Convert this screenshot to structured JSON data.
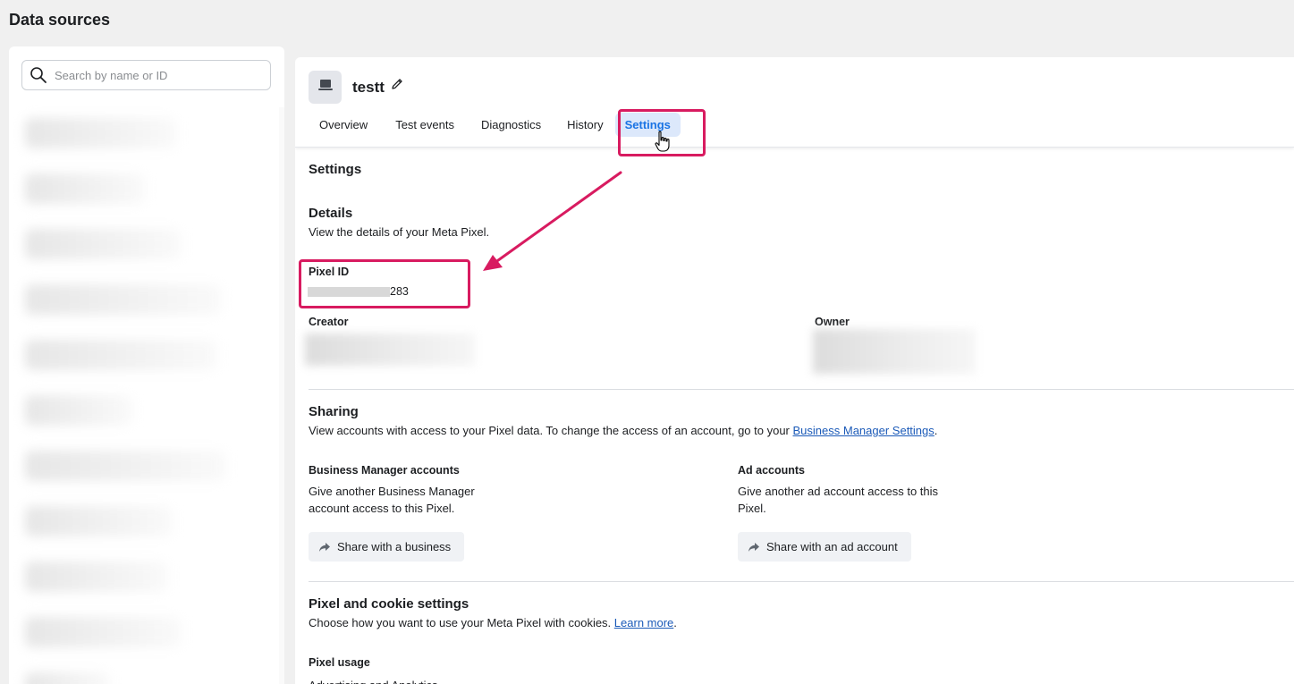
{
  "page": {
    "title": "Data sources"
  },
  "sidebar": {
    "search_placeholder": "Search by name or ID",
    "search_icon": "search-icon"
  },
  "pixel": {
    "name": "testt",
    "tile_icon": "monitor-icon",
    "edit_icon": "pencil-icon"
  },
  "tabs": [
    {
      "label": "Overview"
    },
    {
      "label": "Test events"
    },
    {
      "label": "Diagnostics"
    },
    {
      "label": "History"
    },
    {
      "label": "Settings",
      "active": true
    }
  ],
  "settings": {
    "heading": "Settings",
    "details": {
      "heading": "Details",
      "description": "View the details of your Meta Pixel.",
      "pixel_id_label": "Pixel ID",
      "pixel_id_suffix": "283",
      "creator_label": "Creator",
      "owner_label": "Owner"
    },
    "sharing": {
      "heading": "Sharing",
      "description": "View accounts with access to your Pixel data. To change the access of an account, go to your",
      "link": "Business Manager Settings",
      "after_link": ".",
      "business": {
        "title": "Business Manager accounts",
        "line1": "Give another Business Manager",
        "line2": "account access to this Pixel.",
        "button": "Share with a business",
        "button_icon": "share-arrow-icon"
      },
      "ad": {
        "title": "Ad accounts",
        "line1": "Give another ad account access to this",
        "line2": "Pixel.",
        "button": "Share with an ad account",
        "button_icon": "share-arrow-icon"
      }
    },
    "cookie": {
      "heading": "Pixel and cookie settings",
      "description": "Choose how you want to use your Meta Pixel with cookies.",
      "link": "Learn more",
      "after_link": ".",
      "usage_label": "Pixel usage",
      "usage_value": "Advertising and Analytics"
    }
  },
  "colors": {
    "annotation": "#d81b60",
    "active_tab_bg": "#dce8fb",
    "active_tab_text": "#1b74e4",
    "link": "#1b5ab8"
  }
}
